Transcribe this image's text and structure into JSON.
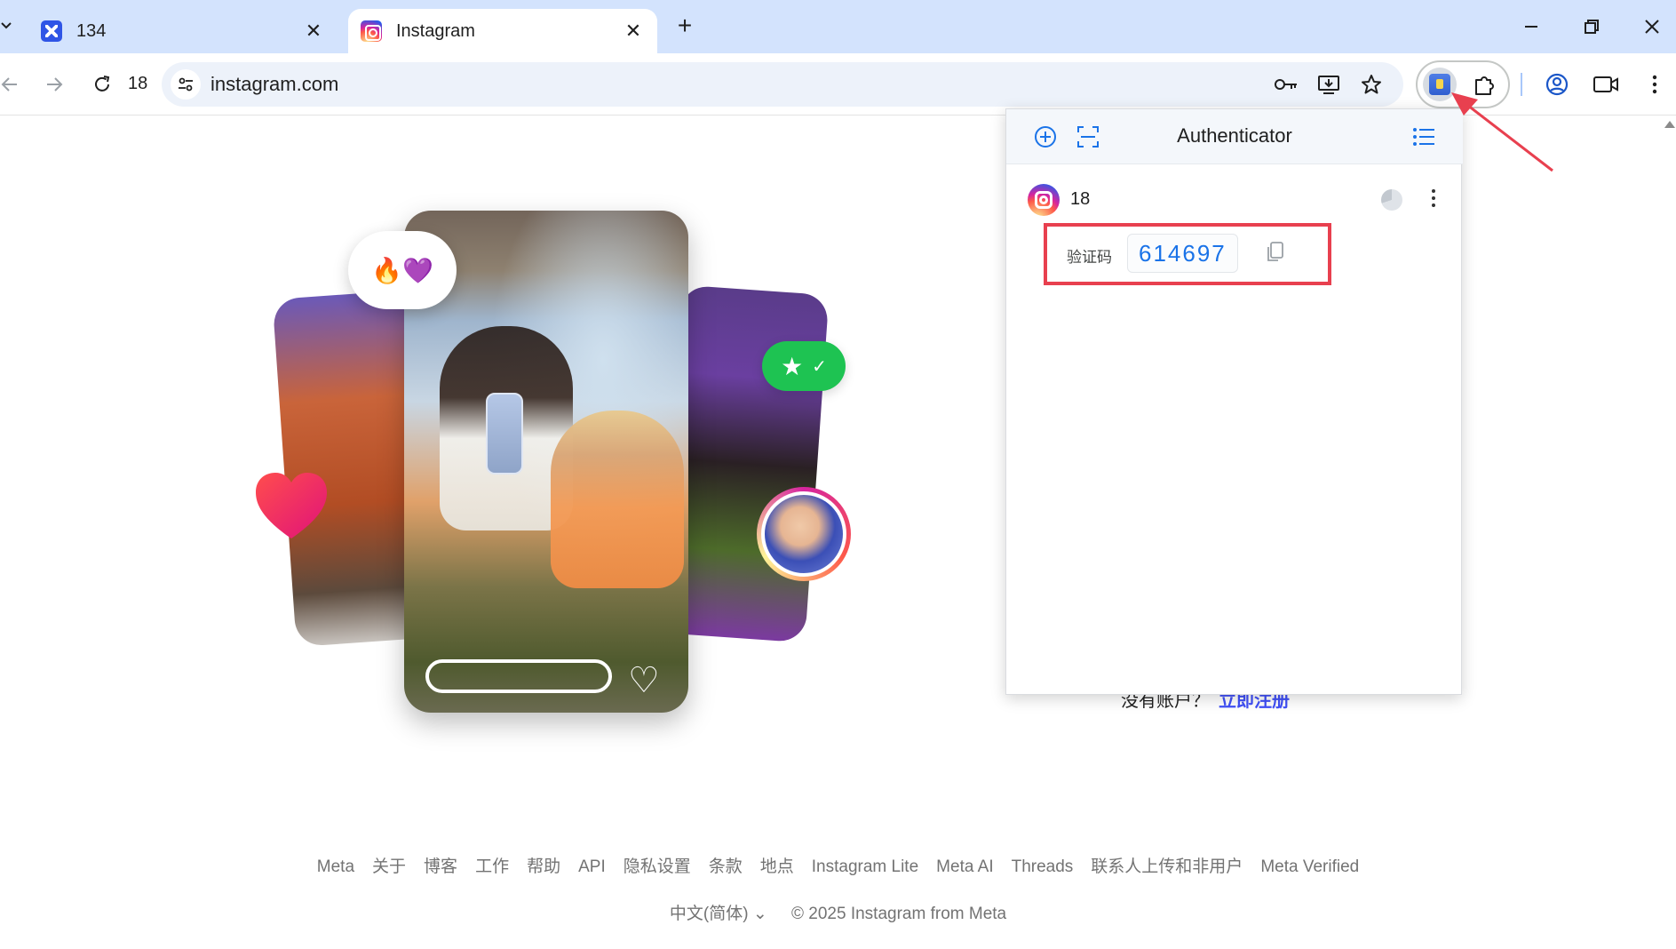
{
  "browser": {
    "tabs": [
      {
        "title": "134",
        "favicon": "app-logo-icon",
        "active": false
      },
      {
        "title": "Instagram",
        "favicon": "instagram-icon",
        "active": true
      }
    ],
    "reload_count": "18",
    "url": "instagram.com"
  },
  "authenticator": {
    "title": "Authenticator",
    "entry": {
      "issuer": "18",
      "code_label": "验证码",
      "code": "614697"
    }
  },
  "page": {
    "signup_prompt": "没有账户？",
    "signup_link": "立即注册",
    "footer_links": [
      "Meta",
      "关于",
      "博客",
      "工作",
      "帮助",
      "API",
      "隐私设置",
      "条款",
      "地点",
      "Instagram Lite",
      "Meta AI",
      "Threads",
      "联系人上传和非用户",
      "Meta Verified"
    ],
    "language": "中文(简体)",
    "copyright": "© 2025 Instagram from Meta"
  },
  "colors": {
    "tabstrip": "#d3e3fd",
    "highlight_box": "#e8404f",
    "code_text": "#1a73e8",
    "signup_link": "#4150f7"
  }
}
